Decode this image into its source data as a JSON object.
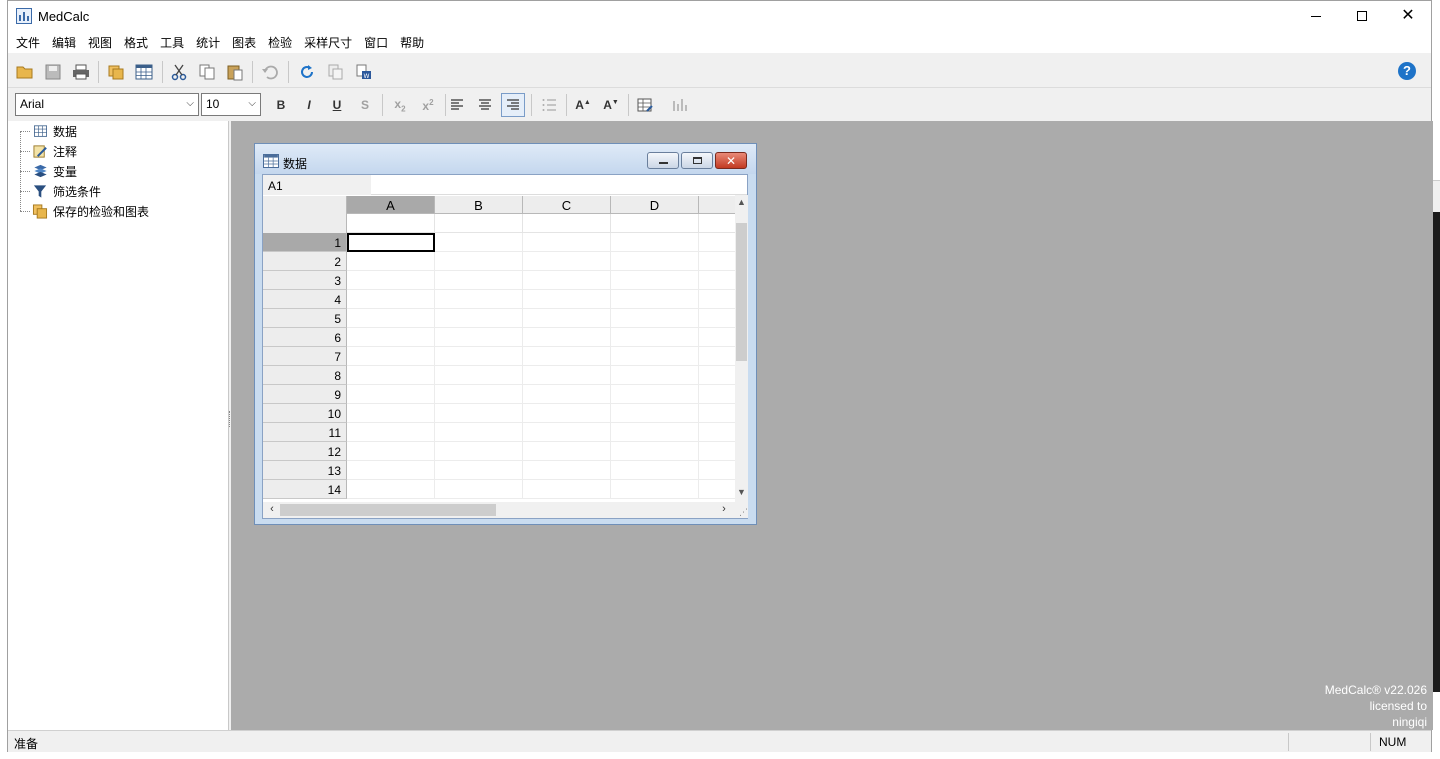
{
  "window": {
    "title": "MedCalc"
  },
  "menu": [
    "文件",
    "编辑",
    "视图",
    "格式",
    "工具",
    "统计",
    "图表",
    "检验",
    "采样尺寸",
    "窗口",
    "帮助"
  ],
  "format_bar": {
    "font": "Arial",
    "size": "10"
  },
  "tree": [
    "数据",
    "注释",
    "变量",
    "筛选条件",
    "保存的检验和图表"
  ],
  "child_window": {
    "title": "数据",
    "cell_ref": "A1"
  },
  "grid": {
    "columns": [
      "A",
      "B",
      "C",
      "D"
    ],
    "rows": [
      "1",
      "2",
      "3",
      "4",
      "5",
      "6",
      "7",
      "8",
      "9",
      "10",
      "11",
      "12",
      "13",
      "14"
    ],
    "selected_column": "A",
    "selected_row": "1"
  },
  "watermark": {
    "line1": "MedCalc® v22.026",
    "line2": "licensed to",
    "line3": "ningiqi"
  },
  "status": {
    "text": "准备",
    "num": "NUM"
  },
  "colors": {
    "mdi_background": "#ababab",
    "child_frame": "#c9dcf0",
    "help_blue": "#1e73c8",
    "close_red": "#c23a22"
  }
}
